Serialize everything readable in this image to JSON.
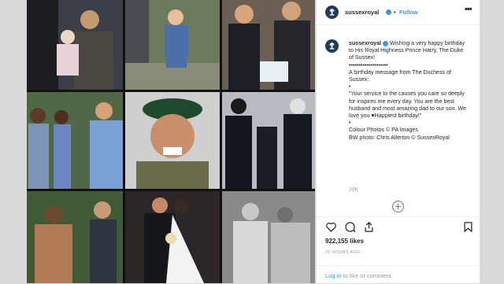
{
  "post": {
    "username": "sussexroyal",
    "follow_label": "Follow",
    "caption": {
      "author": "sussexroyal",
      "lines": [
        "Wishing a very happy birthday to His Royal Highness Prince Harry, The Duke of Sussex!",
        "••••••••••••••••••••",
        "A birthday message from The Duchess of Sussex:",
        "•",
        "\"Your service to the causes you care so deeply for inspires me every day. You are the best husband and most amazing dad to our son. We love you ♥Happiest birthday!\"",
        "•",
        "Colour Photos © PA Images",
        "BW photo: Chris Allerton © SussexRoyal"
      ]
    },
    "caption_time": "20h",
    "likes": "922,155 likes",
    "time_ago": "20 HOURS AGO",
    "login_link": "Log in",
    "login_rest": " to like or comment."
  },
  "colors": {
    "brand": "#1f3a5a",
    "link": "#3897f0"
  },
  "icons": [
    "heart-icon",
    "comment-icon",
    "share-icon",
    "bookmark-icon",
    "more-options-icon",
    "verified-icon",
    "add-comment-icon"
  ],
  "collage": {
    "tiles": [
      {
        "label": "Photo 1",
        "bg": "#6d6256"
      },
      {
        "label": "Photo 2",
        "bg": "#5f6f5a"
      },
      {
        "label": "Photo 3",
        "bg": "#3b3838"
      },
      {
        "label": "Photo 4",
        "bg": "#5a6a53"
      },
      {
        "label": "Photo 5",
        "bg": "#7a7a6a"
      },
      {
        "label": "Photo 6",
        "bg": "#22262e"
      },
      {
        "label": "Photo 7",
        "bg": "#4f5b3c"
      },
      {
        "label": "Photo 8",
        "bg": "#2f2a2a"
      },
      {
        "label": "Photo 9",
        "bg": "#9a9a9a"
      }
    ]
  }
}
